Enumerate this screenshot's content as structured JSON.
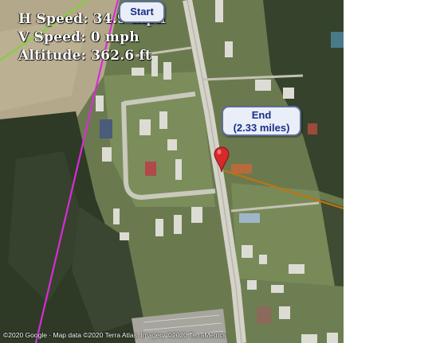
{
  "hud": {
    "h_speed": "H Speed: 34.9 mph",
    "v_speed": "V Speed: 0 mph",
    "altitude": "Altitude: 362.6 ft"
  },
  "markers": {
    "start_label": "Start",
    "end_label": "End",
    "end_distance": "(2.33 miles)"
  },
  "attribution": "©2020 Google · Map data ©2020 Terra Atlas, Imagery ©2020 TerraMetrics",
  "colors": {
    "track_magenta": "#d92bd9",
    "track_green": "#7fd33a",
    "track_orange": "#c0730e",
    "pin_red": "#d8282c",
    "label_text": "#1c2f8a"
  },
  "icons": {
    "end_marker": "map-pin-icon"
  }
}
